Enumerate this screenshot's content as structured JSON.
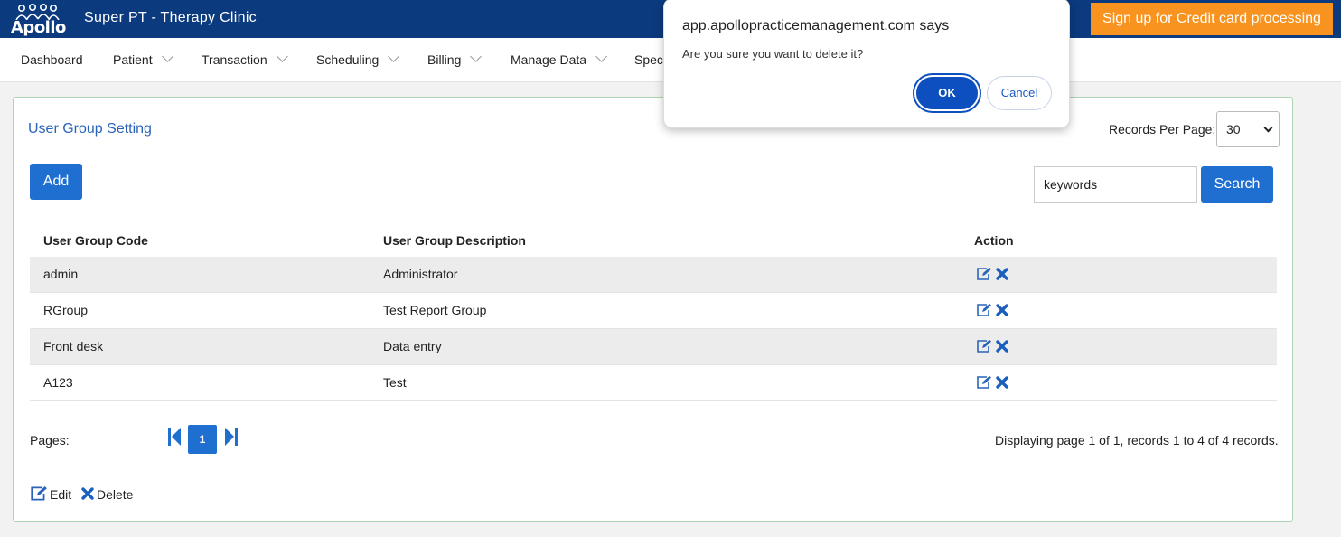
{
  "header": {
    "logo_text": "Apollo",
    "clinic_name": "Super PT - Therapy Clinic",
    "signup_label": "Sign up for Credit card processing"
  },
  "nav": {
    "items": [
      {
        "label": "Dashboard"
      },
      {
        "label": "Patient"
      },
      {
        "label": "Transaction"
      },
      {
        "label": "Scheduling"
      },
      {
        "label": "Billing"
      },
      {
        "label": "Manage Data"
      },
      {
        "label": "Spec"
      }
    ]
  },
  "panel": {
    "title": "User Group Setting",
    "records_per_page_label": "Records Per Page:",
    "records_per_page_value": "30",
    "add_label": "Add",
    "search_value": "keywords",
    "search_label": "Search"
  },
  "table": {
    "headers": [
      "User Group Code",
      "User Group Description",
      "Action"
    ],
    "rows": [
      {
        "code": "admin",
        "description": "Administrator"
      },
      {
        "code": "RGroup",
        "description": "Test Report Group"
      },
      {
        "code": "Front desk",
        "description": "Data entry"
      },
      {
        "code": "A123",
        "description": "Test"
      }
    ]
  },
  "pagination": {
    "pages_label": "Pages:",
    "current_page": "1",
    "status": "Displaying page 1 of 1, records 1 to 4 of 4 records."
  },
  "legend": {
    "edit_label": "Edit",
    "delete_label": "Delete"
  },
  "dialog": {
    "title": "app.apollopracticemanagement.com says",
    "message": "Are you sure you want to delete it?",
    "ok_label": "OK",
    "cancel_label": "Cancel"
  },
  "colors": {
    "header_bg": "#0b3a7e",
    "accent_blue": "#1f6fd1",
    "signup_orange": "#f7931e",
    "panel_border": "#a9d5b0"
  }
}
